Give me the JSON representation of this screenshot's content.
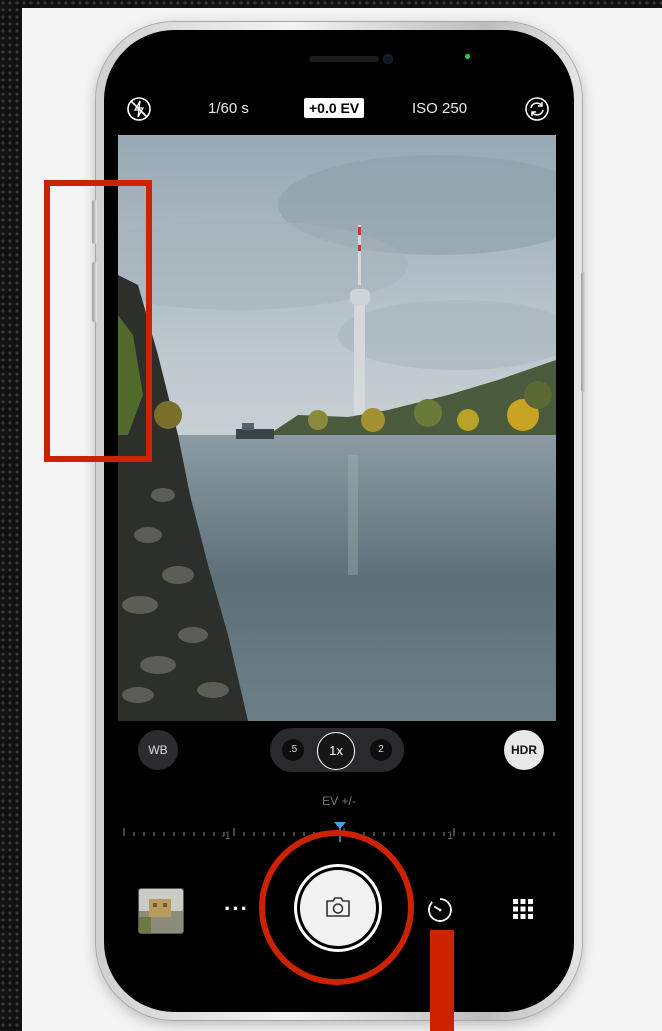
{
  "camera": {
    "top_bar": {
      "flash_icon": "flash-off-icon",
      "shutter_speed": "1/60 s",
      "exposure_value": "+0.0 EV",
      "iso": "ISO 250",
      "flip_icon": "camera-flip-icon"
    },
    "controls": {
      "wb_label": "WB",
      "zoom_options": [
        ".5",
        "1x",
        "2"
      ],
      "zoom_selected": "1x",
      "hdr_label": "HDR"
    },
    "ev_slider": {
      "label": "EV +/-",
      "tick_labels": [
        "-1",
        "1"
      ],
      "value": 0
    },
    "bottom_bar": {
      "more_label": "···",
      "shutter_icon": "camera-icon",
      "timer_icon": "timer-icon",
      "grid_icon": "grid-icon"
    }
  },
  "annotations": {
    "color": "#cc2200"
  }
}
